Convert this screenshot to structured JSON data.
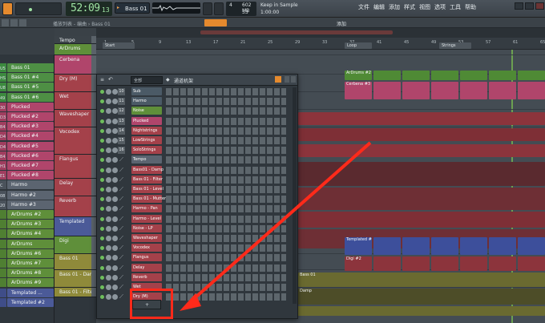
{
  "toolbar": {
    "time_main": "52:09",
    "time_frac": "13",
    "pattern_name": "Bass 01",
    "cpu_top": "4",
    "cpu_mem": "602 MB",
    "cpu_poly": "33",
    "hint_text": "Keep in Sample",
    "hint_time": "1:00:00",
    "menu": [
      "文件",
      "编辑",
      "添加",
      "样式",
      "视图",
      "选项",
      "工具",
      "帮助"
    ],
    "browser_label": "播放列表 - 编曲 › Bass 01",
    "add_label": "添加"
  },
  "browser": {
    "items": [
      {
        "label": "Bass 01",
        "color": "#4e8f44",
        "rail": "#3c8a3f"
      },
      {
        "label": "Bass 01 #4",
        "color": "#4e8f44",
        "rail": "#3c8a3f"
      },
      {
        "label": "Bass 01 #5",
        "color": "#4e8f44",
        "rail": "#3c8a3f"
      },
      {
        "label": "Bass 01 #6",
        "color": "#4e8f44",
        "rail": "#3c8a3f"
      },
      {
        "label": "Plucked",
        "color": "#b0456b",
        "rail": "#a03e5f"
      },
      {
        "label": "Plucked #2",
        "color": "#b0456b",
        "rail": "#a03e5f"
      },
      {
        "label": "Plucked #3",
        "color": "#b0456b",
        "rail": "#a03e5f"
      },
      {
        "label": "Plucked #4",
        "color": "#b0456b",
        "rail": "#a03e5f"
      },
      {
        "label": "Plucked #5",
        "color": "#b0456b",
        "rail": "#a03e5f"
      },
      {
        "label": "Plucked #6",
        "color": "#b0456b",
        "rail": "#a03e5f"
      },
      {
        "label": "Plucked #7",
        "color": "#b0456b",
        "rail": "#a03e5f"
      },
      {
        "label": "Plucked #8",
        "color": "#b0456b",
        "rail": "#a03e5f"
      },
      {
        "label": "Harmo",
        "color": "#5b6470",
        "rail": "#4a525b"
      },
      {
        "label": "Harmo #2",
        "color": "#5b6470",
        "rail": "#4a525b"
      },
      {
        "label": "Harmo #3",
        "color": "#5b6470",
        "rail": "#4a525b"
      },
      {
        "label": "ArDrums #2",
        "color": "#5f8f3a",
        "rail": "#4f7f32"
      },
      {
        "label": "ArDrums #3",
        "color": "#5f8f3a",
        "rail": "#4f7f32"
      },
      {
        "label": "ArDrums #4",
        "color": "#5f8f3a",
        "rail": "#4f7f32"
      },
      {
        "label": "ArDrums",
        "color": "#5f8f3a",
        "rail": "#4f7f32"
      },
      {
        "label": "ArDrums #6",
        "color": "#5f8f3a",
        "rail": "#4f7f32"
      },
      {
        "label": "ArDrums #7",
        "color": "#5f8f3a",
        "rail": "#4f7f32"
      },
      {
        "label": "ArDrums #8",
        "color": "#5f8f3a",
        "rail": "#4f7f32"
      },
      {
        "label": "ArDrums #9",
        "color": "#5f8f3a",
        "rail": "#4f7f32"
      },
      {
        "label": "Templated ...",
        "color": "#4b5a98",
        "rail": "#3f4d88"
      },
      {
        "label": "Templated #2",
        "color": "#4b5a98",
        "rail": "#3f4d88"
      }
    ],
    "rail_labels": [
      "U5",
      "HS",
      "U8",
      "49",
      "30",
      "D3",
      "B4",
      "D4",
      "D4",
      "B4",
      "H1",
      "E1",
      "C",
      "08",
      "20"
    ]
  },
  "playlist": {
    "tracks": [
      {
        "name": "Tempo",
        "color": "#3b4248",
        "height": 10
      },
      {
        "name": "ArDrums",
        "color": "#5f8f3a",
        "height": 14
      },
      {
        "name": "Cerbena",
        "color": "#b0456b",
        "height": 24
      },
      {
        "name": "Dry (M)",
        "color": "#a4414a",
        "height": 22
      },
      {
        "name": "Wet",
        "color": "#a4414a",
        "height": 22
      },
      {
        "name": "Waveshaper",
        "color": "#a4414a",
        "height": 22
      },
      {
        "name": "Vocodex",
        "color": "#a4414a",
        "height": 34
      },
      {
        "name": "Flangus",
        "color": "#a4414a",
        "height": 30
      },
      {
        "name": "Delay",
        "color": "#a4414a",
        "height": 22
      },
      {
        "name": "Reverb",
        "color": "#a4414a",
        "height": 26
      },
      {
        "name": "Templated",
        "color": "#4b5a98",
        "height": 24
      },
      {
        "name": "Digi",
        "color": "#5f8f3a",
        "height": 22
      },
      {
        "name": "Bass 01",
        "color": "#8f8a3a",
        "height": 20
      },
      {
        "name": "Bass 01 - Damp",
        "color": "#8f8a3a",
        "height": 22
      },
      {
        "name": "Bass 01 - Filter",
        "color": "#8f8a3a",
        "height": 12
      }
    ],
    "ruler": [
      "1",
      "5",
      "9",
      "13",
      "17",
      "21",
      "25",
      "29",
      "33",
      "37",
      "41",
      "45",
      "49",
      "53",
      "57",
      "61",
      "65"
    ],
    "markers": [
      {
        "label": "Start",
        "color": "#4e565d"
      },
      {
        "label": "Loop",
        "color": "#4e565d"
      },
      {
        "label": "Strings",
        "color": "#4e565d"
      }
    ],
    "clip_labels": {
      "ardrums": "ArDrums #2",
      "cerbena": "Cerbena #3",
      "templated": "Templated #6",
      "digi": "Digi #2",
      "bass": "Bass 01",
      "damp": "Damp",
      "filter": "Bass 01 - Filter"
    }
  },
  "rack": {
    "title": "通道机架",
    "filter": "全部",
    "channels": [
      {
        "num": "10",
        "name": "Sub",
        "color": "#4b5a66"
      },
      {
        "num": "11",
        "name": "Harmo",
        "color": "#4b5a66"
      },
      {
        "num": "12",
        "name": "Noise",
        "color": "#5f8f3a"
      },
      {
        "num": "13",
        "name": "Plucked",
        "color": "#b0456b"
      },
      {
        "num": "14",
        "name": "Nightstrings",
        "color": "#a4414a"
      },
      {
        "num": "15",
        "name": "LowStrings",
        "color": "#a4414a"
      },
      {
        "num": "16",
        "name": "SoloStrings",
        "color": "#a4414a"
      },
      {
        "num": "",
        "name": "Tempo",
        "color": "#5b6470"
      },
      {
        "num": "",
        "name": "Bass01 - Damp",
        "color": "#a4414a"
      },
      {
        "num": "",
        "name": "Bass 01 - Filter",
        "color": "#a4414a"
      },
      {
        "num": "",
        "name": "Bass 01 - Level",
        "color": "#a4414a"
      },
      {
        "num": "",
        "name": "Bass 01 - Mutter",
        "color": "#a4414a"
      },
      {
        "num": "",
        "name": "Harmo - Pan",
        "color": "#a4414a"
      },
      {
        "num": "",
        "name": "Harmo - Level",
        "color": "#a4414a"
      },
      {
        "num": "",
        "name": "Noise - LP",
        "color": "#a4414a"
      },
      {
        "num": "",
        "name": "Waveshaper",
        "color": "#a4414a"
      },
      {
        "num": "",
        "name": "Vocodex",
        "color": "#a4414a"
      },
      {
        "num": "",
        "name": "Flangus",
        "color": "#a4414a"
      },
      {
        "num": "",
        "name": "Delay",
        "color": "#a4414a"
      },
      {
        "num": "",
        "name": "Reverb",
        "color": "#a4414a"
      },
      {
        "num": "",
        "name": "Wet",
        "color": "#a4414a"
      },
      {
        "num": "",
        "name": "Dry (M)",
        "color": "#a4414a"
      }
    ],
    "add_button": "+"
  },
  "colors": {
    "highlight": "#ff2a1a",
    "accent_orange": "#f0a04b",
    "playhead": "#8ee650"
  }
}
